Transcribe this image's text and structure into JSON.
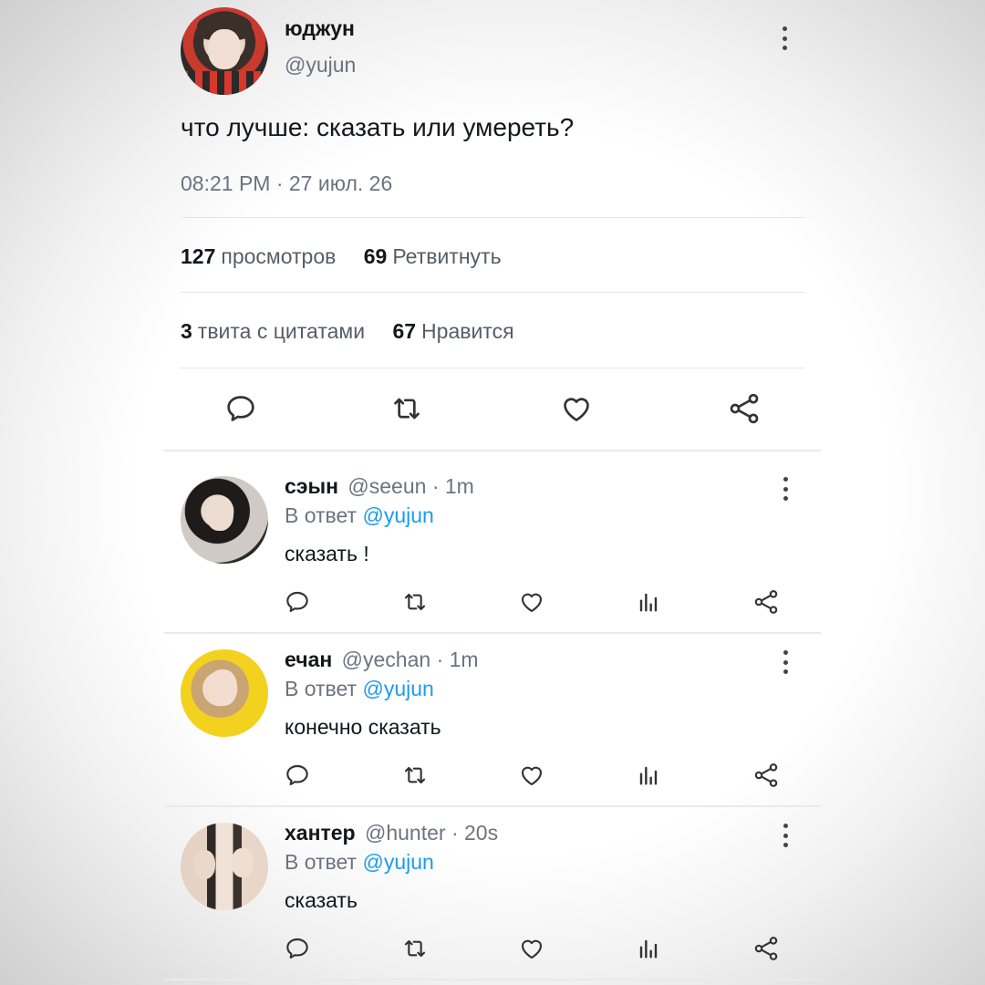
{
  "main_tweet": {
    "author_name": "юджун",
    "author_handle": "@yujun",
    "text": "что лучше: сказать или умереть?",
    "timestamp": "08:21 PM · 27 июл. 26",
    "stats": {
      "views_count": "127",
      "views_label": "просмотров",
      "retweets_count": "69",
      "retweets_label": "Ретвитнуть",
      "quotes_count": "3",
      "quotes_label": "твита с цитатами",
      "likes_count": "67",
      "likes_label": "Нравится"
    },
    "action_icons": [
      "reply-icon",
      "retweet-icon",
      "like-icon",
      "share-icon"
    ]
  },
  "replies": [
    {
      "name": "сэын",
      "handle": "@seeun",
      "time": "· 1m",
      "reply_prefix": "В ответ",
      "reply_mention": "@yujun",
      "text": "сказать !"
    },
    {
      "name": "ечан",
      "handle": "@yechan",
      "time": "· 1m",
      "reply_prefix": "В ответ",
      "reply_mention": "@yujun",
      "text": "конечно сказать"
    },
    {
      "name": "хантер",
      "handle": "@hunter",
      "time": "· 20s",
      "reply_prefix": "В ответ",
      "reply_mention": "@yujun",
      "text": "сказать"
    }
  ],
  "reply_action_icons": [
    "reply-icon",
    "retweet-icon",
    "like-icon",
    "views-icon",
    "share-icon"
  ],
  "colors": {
    "text": "#14171a",
    "secondary": "#6b7480",
    "mention": "#1d9bf0",
    "divider": "#e3e6e8"
  }
}
